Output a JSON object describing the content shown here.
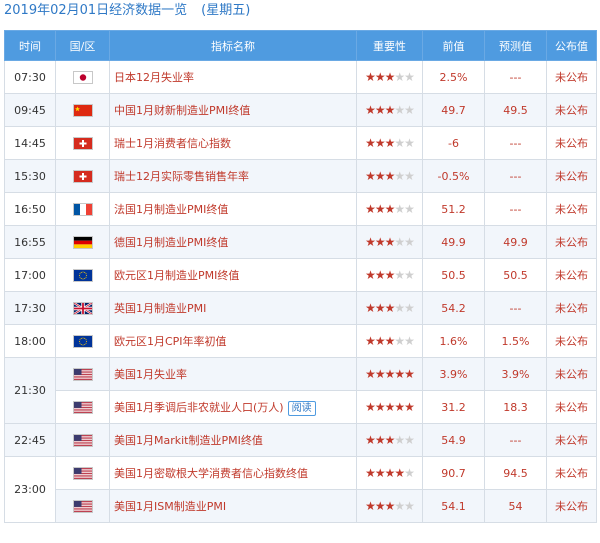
{
  "title": {
    "date": "2019年02月01日经济数据一览",
    "weekday": "(星期五)"
  },
  "headers": [
    "时间",
    "国/区",
    "指标名称",
    "重要性",
    "前值",
    "预测值",
    "公布值"
  ],
  "rows": [
    {
      "time": "07:30",
      "rowspan": 1,
      "flag": "jp",
      "name": "日本12月失业率",
      "stars": 3,
      "prev": "2.5%",
      "fc": "---",
      "pub": "未公布"
    },
    {
      "time": "09:45",
      "rowspan": 1,
      "flag": "cn",
      "name": "中国1月财新制造业PMI终值",
      "stars": 3,
      "prev": "49.7",
      "fc": "49.5",
      "pub": "未公布"
    },
    {
      "time": "14:45",
      "rowspan": 1,
      "flag": "ch",
      "name": "瑞士1月消费者信心指数",
      "stars": 3,
      "prev": "-6",
      "fc": "---",
      "pub": "未公布"
    },
    {
      "time": "15:30",
      "rowspan": 1,
      "flag": "ch",
      "name": "瑞士12月实际零售销售年率",
      "stars": 3,
      "prev": "-0.5%",
      "fc": "---",
      "pub": "未公布"
    },
    {
      "time": "16:50",
      "rowspan": 1,
      "flag": "fr",
      "name": "法国1月制造业PMI终值",
      "stars": 3,
      "prev": "51.2",
      "fc": "---",
      "pub": "未公布"
    },
    {
      "time": "16:55",
      "rowspan": 1,
      "flag": "de",
      "name": "德国1月制造业PMI终值",
      "stars": 3,
      "prev": "49.9",
      "fc": "49.9",
      "pub": "未公布"
    },
    {
      "time": "17:00",
      "rowspan": 1,
      "flag": "eu",
      "name": "欧元区1月制造业PMI终值",
      "stars": 3,
      "prev": "50.5",
      "fc": "50.5",
      "pub": "未公布"
    },
    {
      "time": "17:30",
      "rowspan": 1,
      "flag": "gb",
      "name": "英国1月制造业PMI",
      "stars": 3,
      "prev": "54.2",
      "fc": "---",
      "pub": "未公布"
    },
    {
      "time": "18:00",
      "rowspan": 1,
      "flag": "eu",
      "name": "欧元区1月CPI年率初值",
      "stars": 3,
      "prev": "1.6%",
      "fc": "1.5%",
      "pub": "未公布"
    },
    {
      "time": "21:30",
      "rowspan": 2,
      "flag": "us",
      "name": "美国1月失业率",
      "stars": 5,
      "prev": "3.9%",
      "fc": "3.9%",
      "pub": "未公布"
    },
    {
      "time": "",
      "rowspan": 0,
      "flag": "",
      "name": "美国1月季调后非农就业人口(万人)",
      "tag": "阅读",
      "stars": 5,
      "prev": "31.2",
      "fc": "18.3",
      "pub": "未公布"
    },
    {
      "time": "22:45",
      "rowspan": 1,
      "flag": "us",
      "name": "美国1月Markit制造业PMI终值",
      "stars": 3,
      "prev": "54.9",
      "fc": "---",
      "pub": "未公布"
    },
    {
      "time": "23:00",
      "rowspan": 2,
      "flag": "us",
      "name": "美国1月密歇根大学消费者信心指数终值",
      "stars": 4,
      "prev": "90.7",
      "fc": "94.5",
      "pub": "未公布"
    },
    {
      "time": "",
      "rowspan": 0,
      "flag": "",
      "name": "美国1月ISM制造业PMI",
      "stars": 3,
      "prev": "54.1",
      "fc": "54",
      "pub": "未公布"
    }
  ],
  "flag_icons": {
    "jp": "japan-flag-icon",
    "cn": "china-flag-icon",
    "ch": "switzerland-flag-icon",
    "fr": "france-flag-icon",
    "de": "germany-flag-icon",
    "eu": "eu-flag-icon",
    "gb": "uk-flag-icon",
    "us": "usa-flag-icon"
  },
  "colors": {
    "header_bg": "#4f9be0",
    "title": "#2f79c6",
    "value_red": "#c0392b",
    "star_off": "#cfcfcf",
    "alt_row": "#f2f6fb"
  }
}
